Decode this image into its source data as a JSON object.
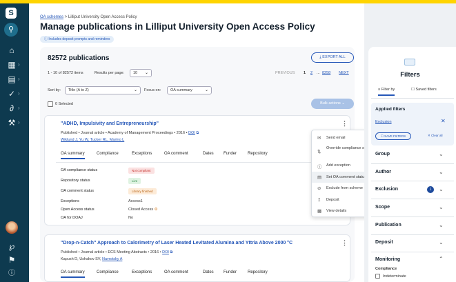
{
  "breadcrumb": {
    "link": "OA schemes",
    "rest": " > Lilliput University Open Access Policy"
  },
  "page_title": "Manage publications in Lilliput University Open Access Policy",
  "pill": "Includes deposit prompts and reminders",
  "count": "82572 publications",
  "export_label": "EXPORT ALL",
  "items_range": "1 - 10 of 82572 items",
  "results_per_page_label": "Results per page:",
  "results_per_page": "10",
  "pagination": {
    "previous": "PREVIOUS",
    "p1": "1",
    "p2": "2",
    "ellipsis": "...",
    "last": "8258",
    "next": "NEXT"
  },
  "sort_label": "Sort by:",
  "sort_value": "Title (A to Z)",
  "focus_label": "Focus on:",
  "focus_value": "OA summary",
  "selected_label": "0 Selected",
  "bulk_label": "Bulk actions",
  "pub1": {
    "title": "\"ADHD, Impulsivity and Entrepreneurship\"",
    "meta": "Published • Journal article • Academy of Management Proceedings • 2016 •",
    "doi": "DOI",
    "authors": "Wiklund J, Yu W, Tucker RL, Marino L",
    "tabs": [
      "OA summary",
      "Compliance",
      "Exceptions",
      "OA comment",
      "Dates",
      "Funder",
      "Repository"
    ],
    "rows": [
      {
        "label": "OA compliance status",
        "value": "Not compliant"
      },
      {
        "label": "Repository status",
        "value": "Live"
      },
      {
        "label": "OA comment status",
        "value": "Library finished"
      },
      {
        "label": "Exceptions",
        "value": "Access1"
      },
      {
        "label": "Open Access status",
        "value": "Closed Access"
      },
      {
        "label": "OA for DOAJ",
        "value": "No"
      }
    ]
  },
  "menu": [
    {
      "icon": "envelope-icon",
      "label": "Send email"
    },
    {
      "icon": "override-icon",
      "label": "Override compliance status"
    },
    {
      "icon": "info-icon",
      "label": "Add exception"
    },
    {
      "icon": "comment-icon",
      "label": "Set OA comment status"
    },
    {
      "icon": "exclude-icon",
      "label": "Exclude from scheme"
    },
    {
      "icon": "upload-icon",
      "label": "Deposit"
    },
    {
      "icon": "view-icon",
      "label": "View details"
    }
  ],
  "pub2": {
    "title": "\"Drop-n-Catch\" Approach to Calorimetry of Laser Heated Levitated Alumina and Yttria Above 2000 °C",
    "meta": "Published • Journal article • ECS Meeting Abstracts • 2016 •",
    "doi": "DOI",
    "authors_plain": "Kapush D, Ushakov SV, ",
    "authors_link": "Navrotsky A",
    "tabs": [
      "OA summary",
      "Compliance",
      "Exceptions",
      "OA comment",
      "Dates",
      "Funder",
      "Repository"
    ]
  },
  "filters": {
    "title": "Filters",
    "tab_filter": "Filter by",
    "tab_saved": "Saved filters",
    "applied": "Applied filters",
    "exclusion_link": "Exclusion",
    "save_filters": "SAVE FILTERS",
    "clear_all": "Clear all",
    "sections": [
      "Group",
      "Author",
      "Exclusion",
      "Scope",
      "Publication",
      "Deposit",
      "Monitoring"
    ],
    "exclusion_badge": "1",
    "compliance_label": "Compliance",
    "indeterminate": "Indeterminate"
  },
  "colors": {
    "rail": "#0e3a4f",
    "accent": "#2456b8",
    "top_strip": "#ffd400"
  }
}
